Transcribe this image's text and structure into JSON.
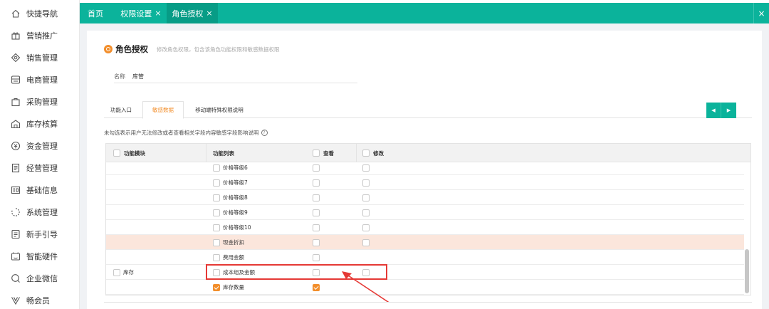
{
  "sidebar": {
    "items": [
      {
        "label": "快捷导航",
        "icon": "home-icon"
      },
      {
        "label": "营销推广",
        "icon": "gift-icon"
      },
      {
        "label": "销售管理",
        "icon": "sales-icon"
      },
      {
        "label": "电商管理",
        "icon": "store-icon"
      },
      {
        "label": "采购管理",
        "icon": "bag-icon"
      },
      {
        "label": "库存核算",
        "icon": "warehouse-icon"
      },
      {
        "label": "资金管理",
        "icon": "money-icon"
      },
      {
        "label": "经营管理",
        "icon": "document-icon"
      },
      {
        "label": "基础信息",
        "icon": "id-card-icon"
      },
      {
        "label": "系统管理",
        "icon": "loading-icon"
      },
      {
        "label": "新手引导",
        "icon": "guide-icon"
      },
      {
        "label": "智能硬件",
        "icon": "device-icon"
      },
      {
        "label": "企业微信",
        "icon": "chat-icon"
      },
      {
        "label": "畅会员",
        "icon": "vip-icon"
      }
    ]
  },
  "top_tabs": [
    {
      "label": "首页",
      "closable": false,
      "active": false
    },
    {
      "label": "权限设置",
      "closable": true,
      "active": false
    },
    {
      "label": "角色授权",
      "closable": true,
      "active": true
    }
  ],
  "top_close": "×",
  "tab_close": "×",
  "heading": {
    "title": "角色授权",
    "desc": "修改角色权限，包含该角色功能权限和敏感数据权限"
  },
  "name_field": {
    "label": "名称",
    "value": "库管"
  },
  "sub_tabs": [
    {
      "label": "功能入口",
      "active": false
    },
    {
      "label": "敏感数据",
      "active": true
    },
    {
      "label": "移动端特殊权限说明",
      "active": false
    }
  ],
  "pager": {
    "prev": "◀",
    "next": "▶"
  },
  "notice": "未勾选表示用户无法修改或者查看相关字段内容敏感字段影响说明",
  "help": "?",
  "table": {
    "headers": {
      "module": "功能模块",
      "func": "功能列表",
      "view": "查看",
      "edit": "修改"
    },
    "rows": [
      {
        "module": "",
        "func": "价格等级6",
        "func_checked": false,
        "view": false,
        "edit": false,
        "has_edit": true,
        "highlight": false
      },
      {
        "module": "",
        "func": "价格等级7",
        "func_checked": false,
        "view": false,
        "edit": false,
        "has_edit": true,
        "highlight": false
      },
      {
        "module": "",
        "func": "价格等级8",
        "func_checked": false,
        "view": false,
        "edit": false,
        "has_edit": true,
        "highlight": false
      },
      {
        "module": "",
        "func": "价格等级9",
        "func_checked": false,
        "view": false,
        "edit": false,
        "has_edit": true,
        "highlight": false
      },
      {
        "module": "",
        "func": "价格等级10",
        "func_checked": false,
        "view": false,
        "edit": false,
        "has_edit": true,
        "highlight": false
      },
      {
        "module": "",
        "func": "现金折扣",
        "func_checked": false,
        "view": false,
        "edit": false,
        "has_edit": true,
        "highlight": true
      },
      {
        "module": "",
        "func": "费用金额",
        "func_checked": false,
        "view": false,
        "edit": false,
        "has_edit": false,
        "highlight": false
      },
      {
        "module": "库存",
        "func": "成本组及金额",
        "func_checked": false,
        "view": false,
        "edit": false,
        "has_edit": true,
        "highlight": false
      },
      {
        "module": "",
        "func": "库存数量",
        "func_checked": true,
        "view": true,
        "edit": false,
        "has_edit": false,
        "highlight": false
      }
    ]
  },
  "colors": {
    "accent": "#0bb39b",
    "orange": "#f28e2b",
    "highlight": "#fbe6dc",
    "annotation": "#e53935"
  }
}
